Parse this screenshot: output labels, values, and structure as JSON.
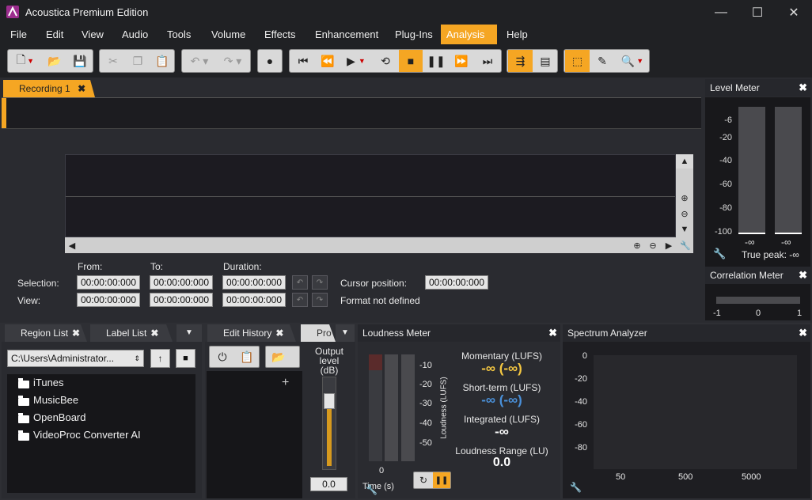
{
  "window": {
    "title": "Acoustica Premium Edition",
    "minimize": "—",
    "maximize": "☐",
    "close": "✕"
  },
  "menu": [
    "File",
    "Edit",
    "View",
    "Audio",
    "Tools",
    "Volume",
    "Effects",
    "Enhancement",
    "Plug-Ins",
    "Analysis",
    "Help"
  ],
  "menu_active": "Analysis",
  "doc_tab": {
    "label": "Recording 1",
    "close": "✖"
  },
  "selection": {
    "from_header": "From:",
    "to_header": "To:",
    "duration_header": "Duration:",
    "selection_label": "Selection:",
    "view_label": "View:",
    "sel_from": "00:00:00:000",
    "sel_to": "00:00:00:000",
    "sel_duration": "00:00:00:000",
    "view_from": "00:00:00:000",
    "view_to": "00:00:00:000",
    "view_duration": "00:00:00:000",
    "cursor_label": "Cursor position:",
    "cursor_value": "00:00:00:000",
    "format_text": "Format not defined"
  },
  "level_meter": {
    "title": "Level Meter",
    "ticks": [
      "-6",
      "-20",
      "-40",
      "-60",
      "-80",
      "-100"
    ],
    "left_value": "-∞",
    "right_value": "-∞",
    "true_peak": "True peak: -∞"
  },
  "correlation_meter": {
    "title": "Correlation Meter",
    "ticks": [
      "-1",
      "0",
      "1"
    ]
  },
  "region_list": {
    "tab": "Region List",
    "label_tab": "Label List",
    "path": "C:\\Users\\Administrator...",
    "folders": [
      "iTunes",
      "MusicBee",
      "OpenBoard",
      "VideoProc Converter AI"
    ]
  },
  "edit_history": {
    "tab": "Edit History",
    "pro_tab": "Pro",
    "output_label_line1": "Output",
    "output_label_line2": "level (dB)",
    "output_value": "0.0",
    "plus": "+"
  },
  "loudness": {
    "title": "Loudness Meter",
    "ticks": [
      "-10",
      "-20",
      "-30",
      "-40",
      "-50"
    ],
    "axis_label": "Loudness (LUFS)",
    "time_zero": "0",
    "time_label": "Time (s)",
    "momentary_label": "Momentary (LUFS)",
    "momentary_value": "-∞ (-∞)",
    "shortterm_label": "Short-term (LUFS)",
    "shortterm_value": "-∞ (-∞)",
    "integrated_label": "Integrated (LUFS)",
    "integrated_value": "-∞",
    "range_label": "Loudness Range (LU)",
    "range_value": "0.0"
  },
  "spectrum": {
    "title": "Spectrum Analyzer",
    "yticks": [
      "0",
      "-20",
      "-40",
      "-60",
      "-80"
    ],
    "xticks": [
      "50",
      "500",
      "5000"
    ]
  },
  "colors": {
    "accent": "#f5a623",
    "momentary": "#f5c842",
    "shortterm": "#4a90d9"
  }
}
